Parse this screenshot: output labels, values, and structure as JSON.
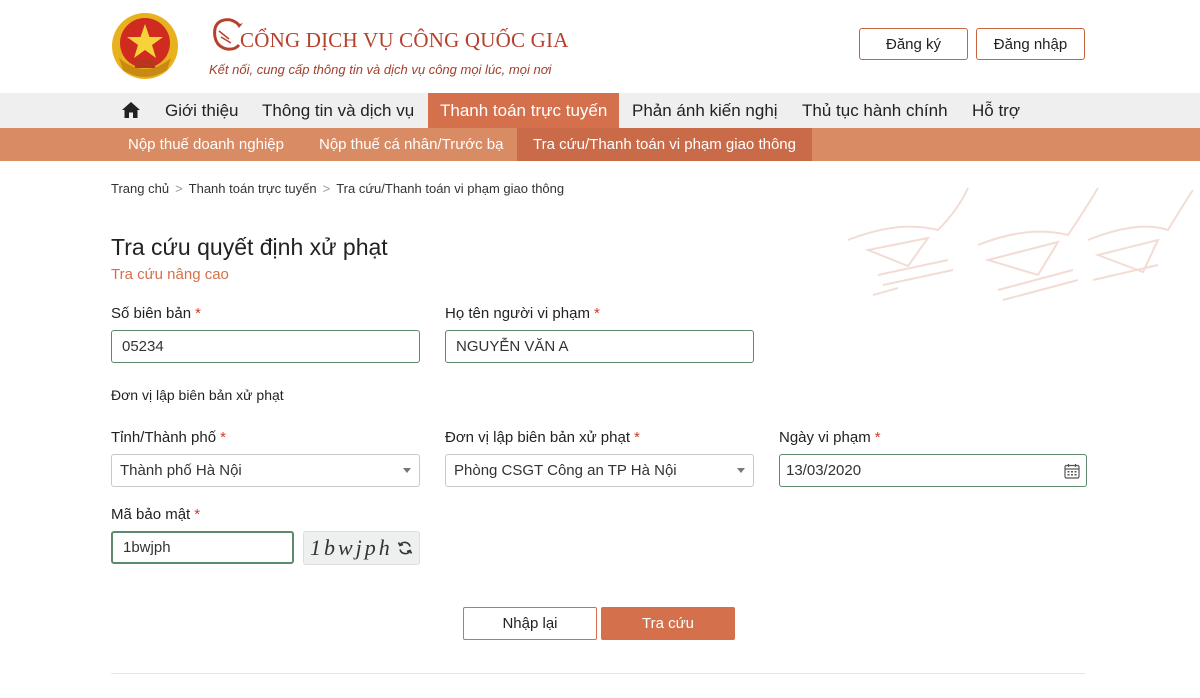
{
  "header": {
    "brand_title": "CỔNG DỊCH VỤ CÔNG QUỐC GIA",
    "tagline": "Kết nối, cung cấp thông tin và dịch vụ công mọi lúc, mọi nơi",
    "register_label": "Đăng ký",
    "login_label": "Đăng nhập"
  },
  "nav": {
    "home_icon": "home-icon",
    "items": [
      {
        "label": "Giới thiệu"
      },
      {
        "label": "Thông tin và dịch vụ"
      },
      {
        "label": "Thanh toán trực tuyến",
        "active": true
      },
      {
        "label": "Phản ánh kiến nghị"
      },
      {
        "label": "Thủ tục hành chính"
      },
      {
        "label": "Hỗ trợ"
      }
    ]
  },
  "subnav": {
    "items": [
      {
        "label": "Nộp thuế doanh nghiệp"
      },
      {
        "label": "Nộp thuế cá nhân/Trước bạ"
      },
      {
        "label": "Tra cứu/Thanh toán vi phạm giao thông",
        "active": true
      }
    ]
  },
  "breadcrumb": {
    "separator": ">",
    "items": [
      "Trang chủ",
      "Thanh toán trực tuyến",
      "Tra cứu/Thanh toán vi phạm giao thông"
    ]
  },
  "main": {
    "title": "Tra cứu quyết định xử phạt",
    "advanced_link": "Tra cứu nâng cao",
    "required_mark": "*",
    "record_number": {
      "label": "Số biên bản",
      "value": "05234"
    },
    "violator_name": {
      "label": "Họ tên người vi phạm",
      "value": "NGUYỄN VĂN A"
    },
    "unit_section_label": "Đơn vị lập biên bản xử phạt",
    "province": {
      "label": "Tỉnh/Thành phố",
      "value": "Thành phố Hà Nội"
    },
    "issuing_unit": {
      "label": "Đơn vị lập biên bản xử phạt",
      "value": "Phòng CSGT Công an TP Hà Nội"
    },
    "violation_date": {
      "label": "Ngày vi phạm",
      "value": "13/03/2020"
    },
    "captcha": {
      "label": "Mã bảo mật",
      "value": "1bwjph",
      "image_text": "1bwjph"
    },
    "reset_label": "Nhập lại",
    "search_label": "Tra cứu"
  },
  "colors": {
    "brand": "#b5412d",
    "accent": "#d5704c",
    "subnav_bg": "#d98b64",
    "required": "#d0392b"
  }
}
